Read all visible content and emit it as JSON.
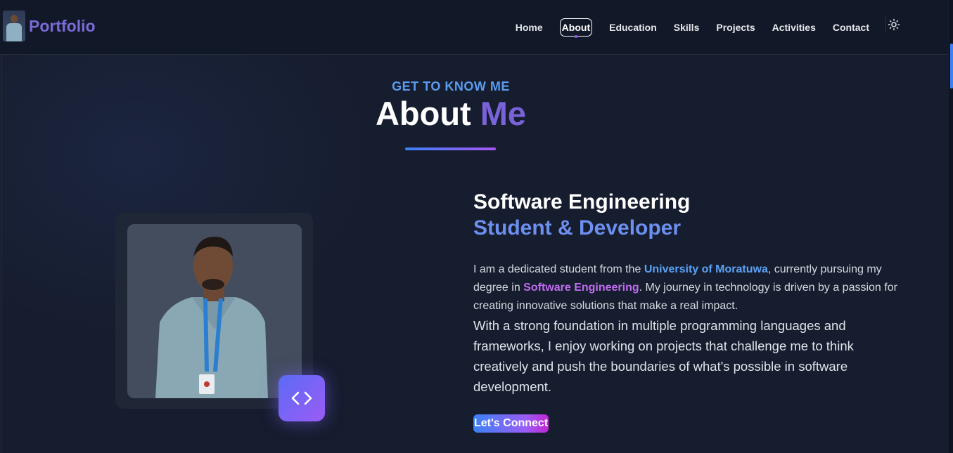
{
  "brand": {
    "name": "Portfolio",
    "avatar_icon": "user-avatar"
  },
  "nav": {
    "items": [
      {
        "label": "Home",
        "active": false
      },
      {
        "label": "About",
        "active": true
      },
      {
        "label": "Education",
        "active": false
      },
      {
        "label": "Skills",
        "active": false
      },
      {
        "label": "Projects",
        "active": false
      },
      {
        "label": "Activities",
        "active": false
      },
      {
        "label": "Contact",
        "active": false
      }
    ],
    "theme_toggle_icon": "sun-icon"
  },
  "section": {
    "eyebrow": "GET TO KNOW ME",
    "heading_main": "About",
    "heading_accent": "Me"
  },
  "profile": {
    "photo_icon": "profile-photo",
    "badge_icon": "code-brackets-icon"
  },
  "about": {
    "title_line1": "Software Engineering",
    "title_line2": "Student & Developer",
    "p1_a": "I am a dedicated student from the ",
    "p1_university": "University of Moratuwa",
    "p1_b": ", currently pursuing my degree in ",
    "p1_degree": "Software Engineering",
    "p1_c": ". My journey in technology is driven by a passion for creating innovative solutions that make a real impact.",
    "p2": "With a strong foundation in multiple programming languages and frameworks, I enjoy working on projects that challenge me to think creatively and push the boundaries of what's possible in software development.",
    "cta_label": "Let's Connect"
  },
  "colors": {
    "background": "#161d2e",
    "navbar": "#111827",
    "accent_blue": "#3b82f6",
    "accent_purple": "#a855f7",
    "brand": "#7a6bd6"
  }
}
